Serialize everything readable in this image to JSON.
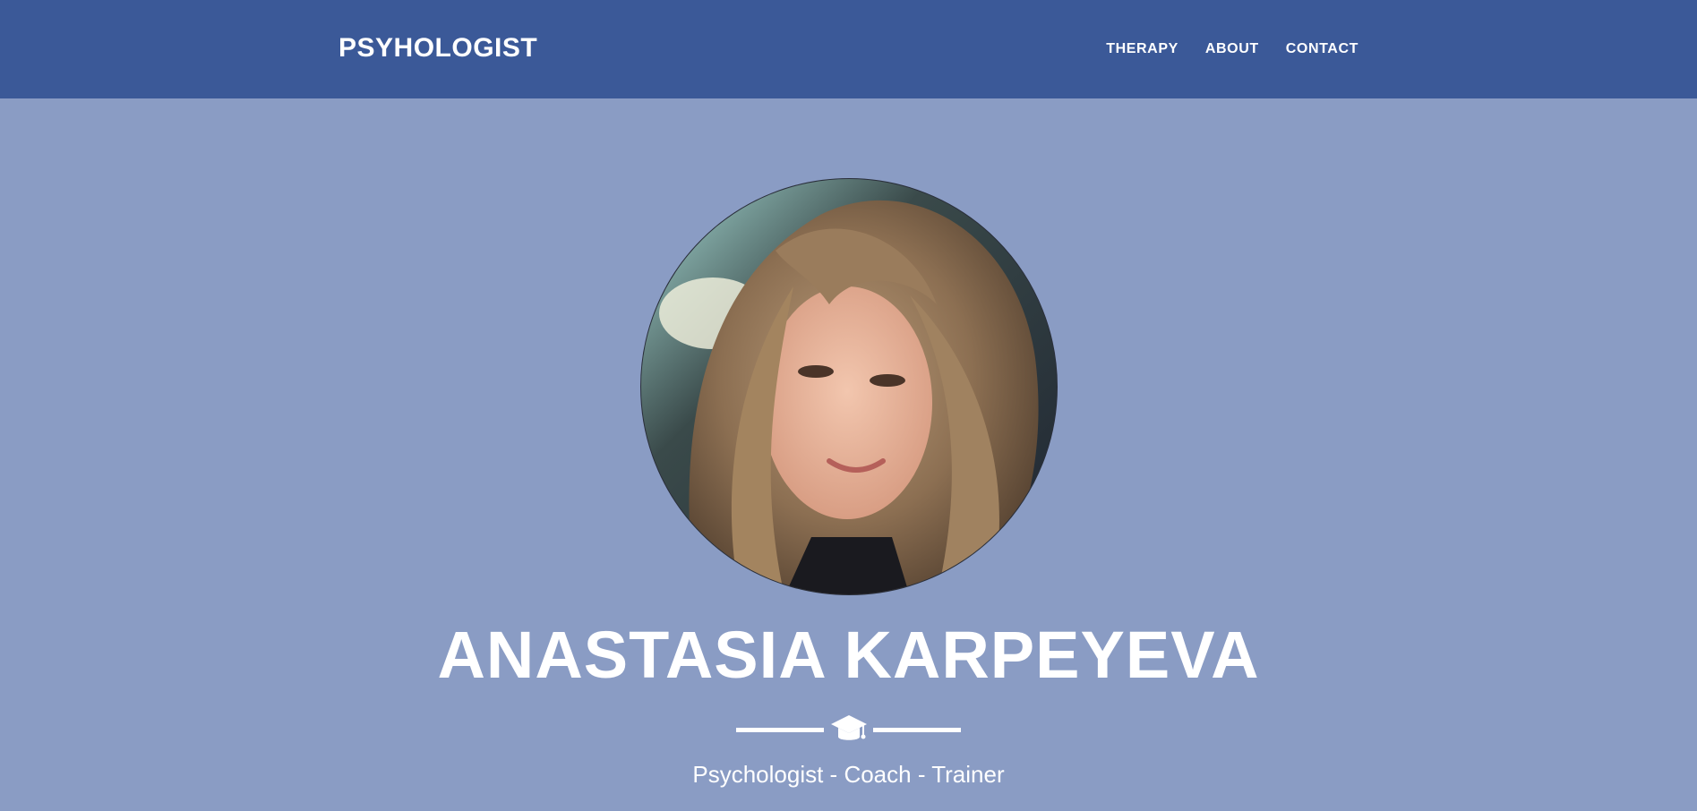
{
  "nav": {
    "brand": "PSYHOLOGIST",
    "links": [
      {
        "label": "THERAPY"
      },
      {
        "label": "ABOUT"
      },
      {
        "label": "CONTACT"
      }
    ]
  },
  "masthead": {
    "avatar_alt": "Portrait photo",
    "name": "ANASTASIA KARPEYEVA",
    "divider_icon": "graduation-cap-icon",
    "subtitle": "Psychologist - Coach - Trainer"
  },
  "colors": {
    "navbar": "#3b5998",
    "background": "#8a9cc4",
    "text": "#ffffff"
  }
}
